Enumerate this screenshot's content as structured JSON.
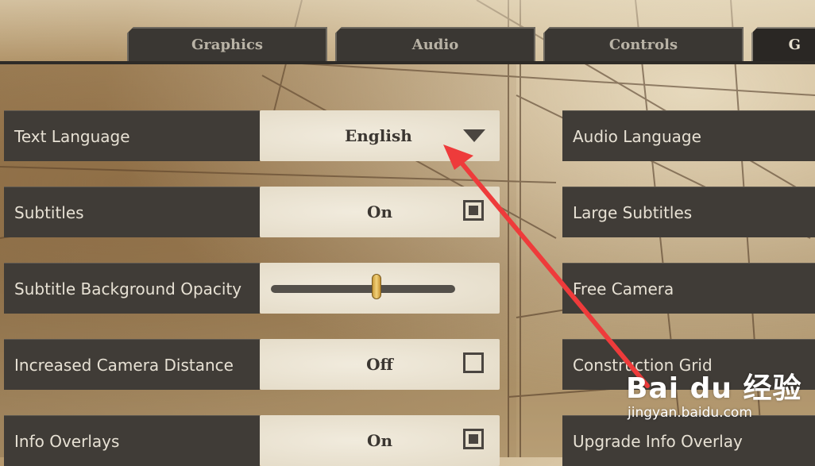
{
  "tabs": [
    {
      "label": "Graphics",
      "active": false
    },
    {
      "label": "Audio",
      "active": false
    },
    {
      "label": "Controls",
      "active": false
    },
    {
      "label": "G",
      "active": true
    }
  ],
  "left_settings": [
    {
      "label": "Text Language",
      "type": "dropdown",
      "value": "English"
    },
    {
      "label": "Subtitles",
      "type": "checkbox",
      "value": "On",
      "checked": true
    },
    {
      "label": "Subtitle Background Opacity",
      "type": "slider",
      "level_percent": 59
    },
    {
      "label": "Increased Camera Distance",
      "type": "checkbox",
      "value": "Off",
      "checked": false
    },
    {
      "label": "Info Overlays",
      "type": "checkbox",
      "value": "On",
      "checked": true
    }
  ],
  "right_settings": [
    {
      "label": "Audio Language"
    },
    {
      "label": "Large Subtitles"
    },
    {
      "label": "Free Camera"
    },
    {
      "label": "Construction Grid"
    },
    {
      "label": "Upgrade Info Overlay"
    }
  ],
  "annotation": {
    "arrow_color": "#ee3b3b"
  },
  "watermark": {
    "brand": "Bai du 经验",
    "site": "jingyan.baidu.com"
  },
  "icons": [
    "dropdown-arrow-icon",
    "checkbox-checked-icon",
    "checkbox-unchecked-icon",
    "slider-thumb-icon"
  ]
}
